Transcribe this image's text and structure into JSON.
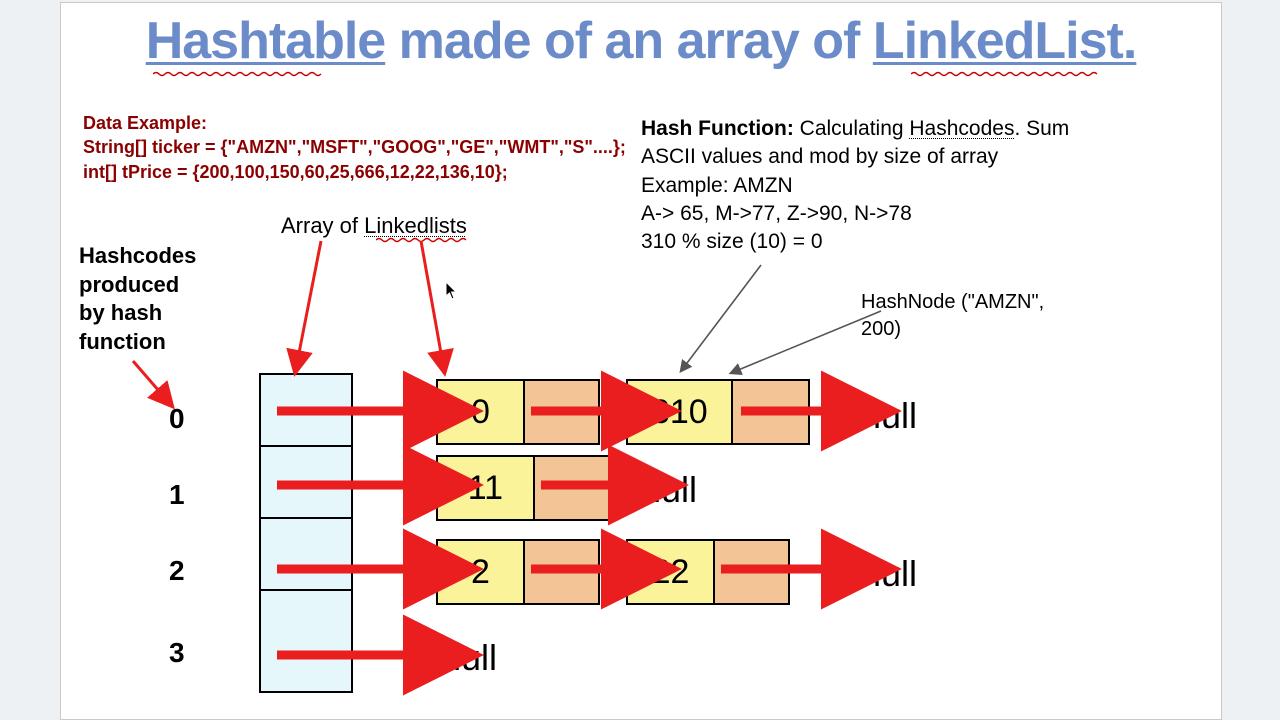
{
  "title_pre": "Hashtable",
  "title_mid": " made of an array of ",
  "title_post": "LinkedList.",
  "data_example_label": "Data Example:",
  "data_example_l1": "String[] ticker = {\"AMZN\",\"MSFT\",\"GOOG\",\"GE\",\"WMT\",\"S\"....};",
  "data_example_l2": " int[] tPrice = {200,100,150,60,25,666,12,22,136,10};",
  "hashfn": {
    "label": "Hash Function:",
    "l1": " Calculating ",
    "l1u": "Hashcodes",
    "l1end": ". Sum",
    "l2": "ASCII values and mod by size of array",
    "l3": "Example: AMZN",
    "l4": "A-> 65, M->77, Z->90, N->78",
    "l5": "310 % size (10) = 0",
    "hashnode": "HashNode (\"AMZN\", 200)"
  },
  "array_label_pre": "Array of ",
  "array_label_u": "Linkedlists",
  "hashcodes_label": "Hashcodes produced by hash function",
  "indices": [
    "0",
    "1",
    "2",
    "3"
  ],
  "rows": [
    {
      "nodes": [
        {
          "v": "0"
        },
        {
          "v": "310"
        }
      ],
      "null": "null"
    },
    {
      "nodes": [
        {
          "v": "11"
        }
      ],
      "null": "null"
    },
    {
      "nodes": [
        {
          "v": "2"
        },
        {
          "v": "22"
        }
      ],
      "null": "null"
    },
    {
      "nodes": [],
      "null": "null"
    }
  ],
  "chart_data": {
    "type": "table",
    "description": "Hashtable implemented as array of linked lists (separate chaining)",
    "hash_function": "sum of ASCII codes of characters, mod array size (10)",
    "example": {
      "key": "AMZN",
      "ascii": [
        65,
        77,
        90,
        78
      ],
      "sum": 310,
      "bucket": 0,
      "value": 200
    },
    "indices_shown": [
      0,
      1,
      2,
      3
    ],
    "buckets": [
      {
        "index": 0,
        "chain": [
          0,
          310
        ],
        "terminator": "null"
      },
      {
        "index": 1,
        "chain": [
          11
        ],
        "terminator": "null"
      },
      {
        "index": 2,
        "chain": [
          2,
          22
        ],
        "terminator": "null"
      },
      {
        "index": 3,
        "chain": [],
        "terminator": "null"
      }
    ],
    "ticker": [
      "AMZN",
      "MSFT",
      "GOOG",
      "GE",
      "WMT",
      "S"
    ],
    "tPrice": [
      200,
      100,
      150,
      60,
      25,
      666,
      12,
      22,
      136,
      10
    ]
  }
}
